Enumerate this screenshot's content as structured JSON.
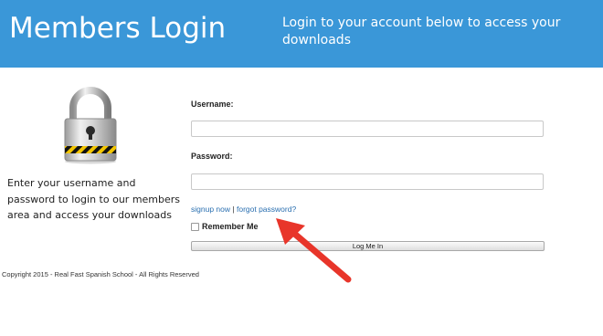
{
  "header": {
    "title": "Members Login",
    "subtitle": "Login to your account below to access your downloads"
  },
  "intro": {
    "caption": "Enter your username and password to login to our members area and access your downloads",
    "image_icon": "padlock-icon"
  },
  "form": {
    "username_label": "Username:",
    "username_value": "",
    "password_label": "Password:",
    "password_value": "",
    "signup_link": "signup now",
    "separator": "|",
    "forgot_link": "forgot password?",
    "remember_label": "Remember Me",
    "remember_checked": false,
    "login_button": "Log Me In"
  },
  "footer": {
    "copyright": "Copyright 2015 - Real Fast Spanish School - All Rights Reserved"
  },
  "colors": {
    "header_bg": "#3a97d8",
    "link": "#2a6fb0",
    "annotation_arrow": "#e8352a"
  }
}
